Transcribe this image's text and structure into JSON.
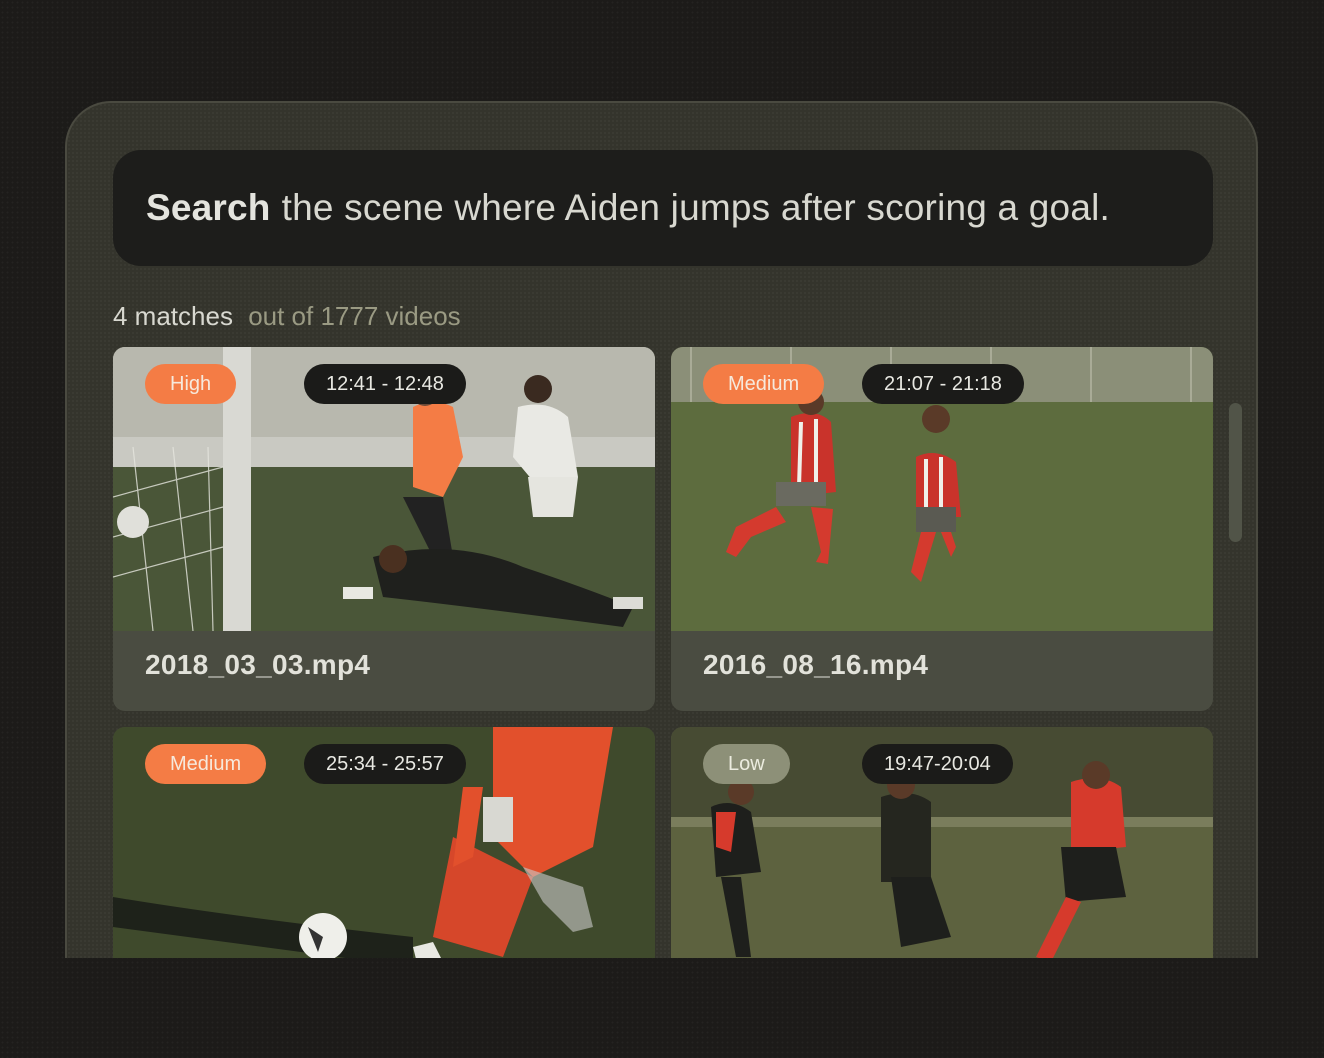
{
  "search": {
    "keyword": "Search",
    "query": "the scene where Aiden jumps after scoring a goal."
  },
  "results": {
    "count_label": "4 matches",
    "total_label": "out of 1777 videos"
  },
  "cards": [
    {
      "confidence": "High",
      "time_range": "12:41 - 12:48",
      "filename": "2018_03_03.mp4",
      "badge_color": "#f47c45"
    },
    {
      "confidence": "Medium",
      "time_range": "21:07 - 21:18",
      "filename": "2016_08_16.mp4",
      "badge_color": "#f47c45"
    },
    {
      "confidence": "Medium",
      "time_range": "25:34 - 25:57",
      "filename": "",
      "badge_color": "#f47c45"
    },
    {
      "confidence": "Low",
      "time_range": "19:47-20:04",
      "filename": "",
      "badge_color": "#8d9078"
    }
  ],
  "colors": {
    "accent": "#f47c45",
    "background": "#1c1b19",
    "panel": "#34342c"
  }
}
